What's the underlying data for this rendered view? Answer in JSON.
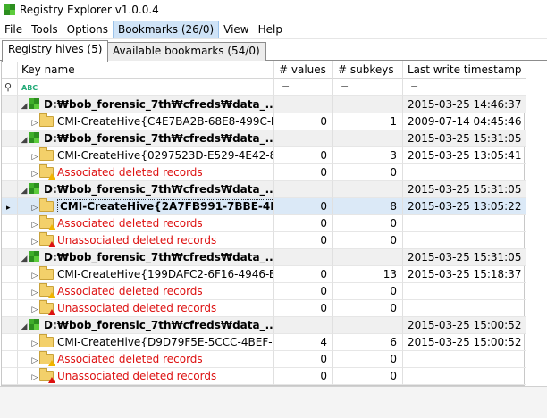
{
  "window": {
    "title": "Registry Explorer v1.0.0.4"
  },
  "menu": [
    "File",
    "Tools",
    "Options",
    "Bookmarks (26/0)",
    "View",
    "Help"
  ],
  "tabs": [
    "Registry hives (5)",
    "Available bookmarks (54/0)"
  ],
  "columns": {
    "key": "Key name",
    "values": "# values",
    "subkeys": "# subkeys",
    "timestamp": "Last write timestamp"
  },
  "filter": {
    "eq": "="
  },
  "rows": [
    {
      "type": "hive",
      "key": "D:₩bob_forensic_7th₩cfreds₩data_...",
      "values": "",
      "subkeys": "",
      "ts": "2015-03-25 14:46:37"
    },
    {
      "type": "key",
      "key": "CMI-CreateHive{C4E7BA2B-68E8-499C-B...",
      "values": "0",
      "subkeys": "1",
      "ts": "2009-07-14 04:45:46"
    },
    {
      "type": "hive",
      "key": "D:₩bob_forensic_7th₩cfreds₩data_...",
      "values": "",
      "subkeys": "",
      "ts": "2015-03-25 15:31:05"
    },
    {
      "type": "key",
      "key": "CMI-CreateHive{0297523D-E529-4E42-8...",
      "values": "0",
      "subkeys": "3",
      "ts": "2015-03-25 13:05:41"
    },
    {
      "type": "assoc",
      "key": "Associated deleted records",
      "values": "0",
      "subkeys": "0",
      "ts": ""
    },
    {
      "type": "hive",
      "key": "D:₩bob_forensic_7th₩cfreds₩data_...",
      "values": "",
      "subkeys": "",
      "ts": "2015-03-25 15:31:05"
    },
    {
      "type": "key",
      "selected": true,
      "key": "CMI-CreateHive{2A7FB991-7BBE-4F...",
      "values": "0",
      "subkeys": "8",
      "ts": "2015-03-25 13:05:22"
    },
    {
      "type": "assoc",
      "key": "Associated deleted records",
      "values": "0",
      "subkeys": "0",
      "ts": ""
    },
    {
      "type": "unassoc",
      "key": "Unassociated deleted records",
      "values": "0",
      "subkeys": "0",
      "ts": ""
    },
    {
      "type": "hive",
      "key": "D:₩bob_forensic_7th₩cfreds₩data_...",
      "values": "",
      "subkeys": "",
      "ts": "2015-03-25 15:31:05"
    },
    {
      "type": "key",
      "key": "CMI-CreateHive{199DAFC2-6F16-4946-B...",
      "values": "0",
      "subkeys": "13",
      "ts": "2015-03-25 15:18:37"
    },
    {
      "type": "assoc",
      "key": "Associated deleted records",
      "values": "0",
      "subkeys": "0",
      "ts": ""
    },
    {
      "type": "unassoc",
      "key": "Unassociated deleted records",
      "values": "0",
      "subkeys": "0",
      "ts": ""
    },
    {
      "type": "hive",
      "key": "D:₩bob_forensic_7th₩cfreds₩data_...",
      "values": "",
      "subkeys": "",
      "ts": "2015-03-25 15:00:52"
    },
    {
      "type": "key",
      "key": "CMI-CreateHive{D9D79F5E-5CCC-4BEF-B...",
      "values": "4",
      "subkeys": "6",
      "ts": "2015-03-25 15:00:52"
    },
    {
      "type": "assoc",
      "key": "Associated deleted records",
      "values": "0",
      "subkeys": "0",
      "ts": ""
    },
    {
      "type": "unassoc",
      "key": "Unassociated deleted records",
      "values": "0",
      "subkeys": "0",
      "ts": ""
    }
  ],
  "colors": {
    "deleted_text": "#dd1111",
    "selected_row": "#dbe9f7",
    "group_row": "#f0f0f0"
  },
  "icons": {
    "hive": "hive-icon",
    "key": "folder-icon",
    "assoc": "folder-warning-icon",
    "unassoc": "folder-error-icon",
    "pin": "pin-icon",
    "text-filter": "abc-filter-icon"
  }
}
